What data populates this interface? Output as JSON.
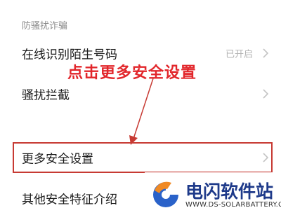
{
  "section": {
    "header": "防骚扰诈骗"
  },
  "rows": [
    {
      "label": "在线识别陌生号码",
      "status": "已开启"
    },
    {
      "label": "骚扰拦截",
      "status": ""
    },
    {
      "label": "更多安全设置",
      "status": ""
    },
    {
      "label": "其他安全特征介绍",
      "status": ""
    }
  ],
  "annotation": {
    "text": "点击更多安全设置",
    "color": "#e2262b"
  },
  "watermark": {
    "title": "电闪软件站",
    "url": "WWW.DS-SOLARBATTERY.COM"
  },
  "icons": {
    "row_chevron": "chevron-right-icon",
    "logo": "ds-logo-icon"
  },
  "colors": {
    "highlight_border": "#c73a33",
    "status_text": "#b3b3b3",
    "section_header": "#8a8a8a"
  }
}
